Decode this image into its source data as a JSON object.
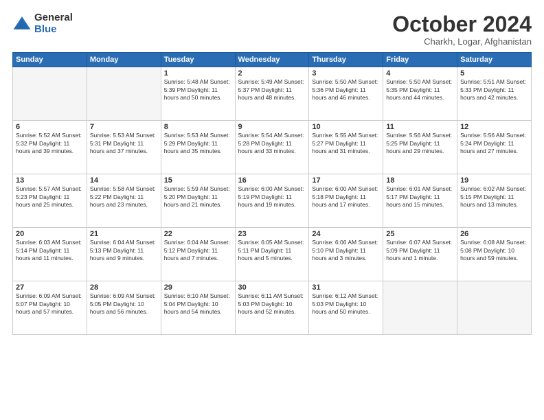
{
  "logo": {
    "general": "General",
    "blue": "Blue"
  },
  "title": "October 2024",
  "subtitle": "Charkh, Logar, Afghanistan",
  "weekdays": [
    "Sunday",
    "Monday",
    "Tuesday",
    "Wednesday",
    "Thursday",
    "Friday",
    "Saturday"
  ],
  "weeks": [
    [
      {
        "day": "",
        "info": ""
      },
      {
        "day": "",
        "info": ""
      },
      {
        "day": "1",
        "info": "Sunrise: 5:48 AM\nSunset: 5:39 PM\nDaylight: 11 hours and 50 minutes."
      },
      {
        "day": "2",
        "info": "Sunrise: 5:49 AM\nSunset: 5:37 PM\nDaylight: 11 hours and 48 minutes."
      },
      {
        "day": "3",
        "info": "Sunrise: 5:50 AM\nSunset: 5:36 PM\nDaylight: 11 hours and 46 minutes."
      },
      {
        "day": "4",
        "info": "Sunrise: 5:50 AM\nSunset: 5:35 PM\nDaylight: 11 hours and 44 minutes."
      },
      {
        "day": "5",
        "info": "Sunrise: 5:51 AM\nSunset: 5:33 PM\nDaylight: 11 hours and 42 minutes."
      }
    ],
    [
      {
        "day": "6",
        "info": "Sunrise: 5:52 AM\nSunset: 5:32 PM\nDaylight: 11 hours and 39 minutes."
      },
      {
        "day": "7",
        "info": "Sunrise: 5:53 AM\nSunset: 5:31 PM\nDaylight: 11 hours and 37 minutes."
      },
      {
        "day": "8",
        "info": "Sunrise: 5:53 AM\nSunset: 5:29 PM\nDaylight: 11 hours and 35 minutes."
      },
      {
        "day": "9",
        "info": "Sunrise: 5:54 AM\nSunset: 5:28 PM\nDaylight: 11 hours and 33 minutes."
      },
      {
        "day": "10",
        "info": "Sunrise: 5:55 AM\nSunset: 5:27 PM\nDaylight: 11 hours and 31 minutes."
      },
      {
        "day": "11",
        "info": "Sunrise: 5:56 AM\nSunset: 5:25 PM\nDaylight: 11 hours and 29 minutes."
      },
      {
        "day": "12",
        "info": "Sunrise: 5:56 AM\nSunset: 5:24 PM\nDaylight: 11 hours and 27 minutes."
      }
    ],
    [
      {
        "day": "13",
        "info": "Sunrise: 5:57 AM\nSunset: 5:23 PM\nDaylight: 11 hours and 25 minutes."
      },
      {
        "day": "14",
        "info": "Sunrise: 5:58 AM\nSunset: 5:22 PM\nDaylight: 11 hours and 23 minutes."
      },
      {
        "day": "15",
        "info": "Sunrise: 5:59 AM\nSunset: 5:20 PM\nDaylight: 11 hours and 21 minutes."
      },
      {
        "day": "16",
        "info": "Sunrise: 6:00 AM\nSunset: 5:19 PM\nDaylight: 11 hours and 19 minutes."
      },
      {
        "day": "17",
        "info": "Sunrise: 6:00 AM\nSunset: 5:18 PM\nDaylight: 11 hours and 17 minutes."
      },
      {
        "day": "18",
        "info": "Sunrise: 6:01 AM\nSunset: 5:17 PM\nDaylight: 11 hours and 15 minutes."
      },
      {
        "day": "19",
        "info": "Sunrise: 6:02 AM\nSunset: 5:15 PM\nDaylight: 11 hours and 13 minutes."
      }
    ],
    [
      {
        "day": "20",
        "info": "Sunrise: 6:03 AM\nSunset: 5:14 PM\nDaylight: 11 hours and 11 minutes."
      },
      {
        "day": "21",
        "info": "Sunrise: 6:04 AM\nSunset: 5:13 PM\nDaylight: 11 hours and 9 minutes."
      },
      {
        "day": "22",
        "info": "Sunrise: 6:04 AM\nSunset: 5:12 PM\nDaylight: 11 hours and 7 minutes."
      },
      {
        "day": "23",
        "info": "Sunrise: 6:05 AM\nSunset: 5:11 PM\nDaylight: 11 hours and 5 minutes."
      },
      {
        "day": "24",
        "info": "Sunrise: 6:06 AM\nSunset: 5:10 PM\nDaylight: 11 hours and 3 minutes."
      },
      {
        "day": "25",
        "info": "Sunrise: 6:07 AM\nSunset: 5:09 PM\nDaylight: 11 hours and 1 minute."
      },
      {
        "day": "26",
        "info": "Sunrise: 6:08 AM\nSunset: 5:08 PM\nDaylight: 10 hours and 59 minutes."
      }
    ],
    [
      {
        "day": "27",
        "info": "Sunrise: 6:09 AM\nSunset: 5:07 PM\nDaylight: 10 hours and 57 minutes."
      },
      {
        "day": "28",
        "info": "Sunrise: 6:09 AM\nSunset: 5:05 PM\nDaylight: 10 hours and 56 minutes."
      },
      {
        "day": "29",
        "info": "Sunrise: 6:10 AM\nSunset: 5:04 PM\nDaylight: 10 hours and 54 minutes."
      },
      {
        "day": "30",
        "info": "Sunrise: 6:11 AM\nSunset: 5:03 PM\nDaylight: 10 hours and 52 minutes."
      },
      {
        "day": "31",
        "info": "Sunrise: 6:12 AM\nSunset: 5:03 PM\nDaylight: 10 hours and 50 minutes."
      },
      {
        "day": "",
        "info": ""
      },
      {
        "day": "",
        "info": ""
      }
    ]
  ]
}
